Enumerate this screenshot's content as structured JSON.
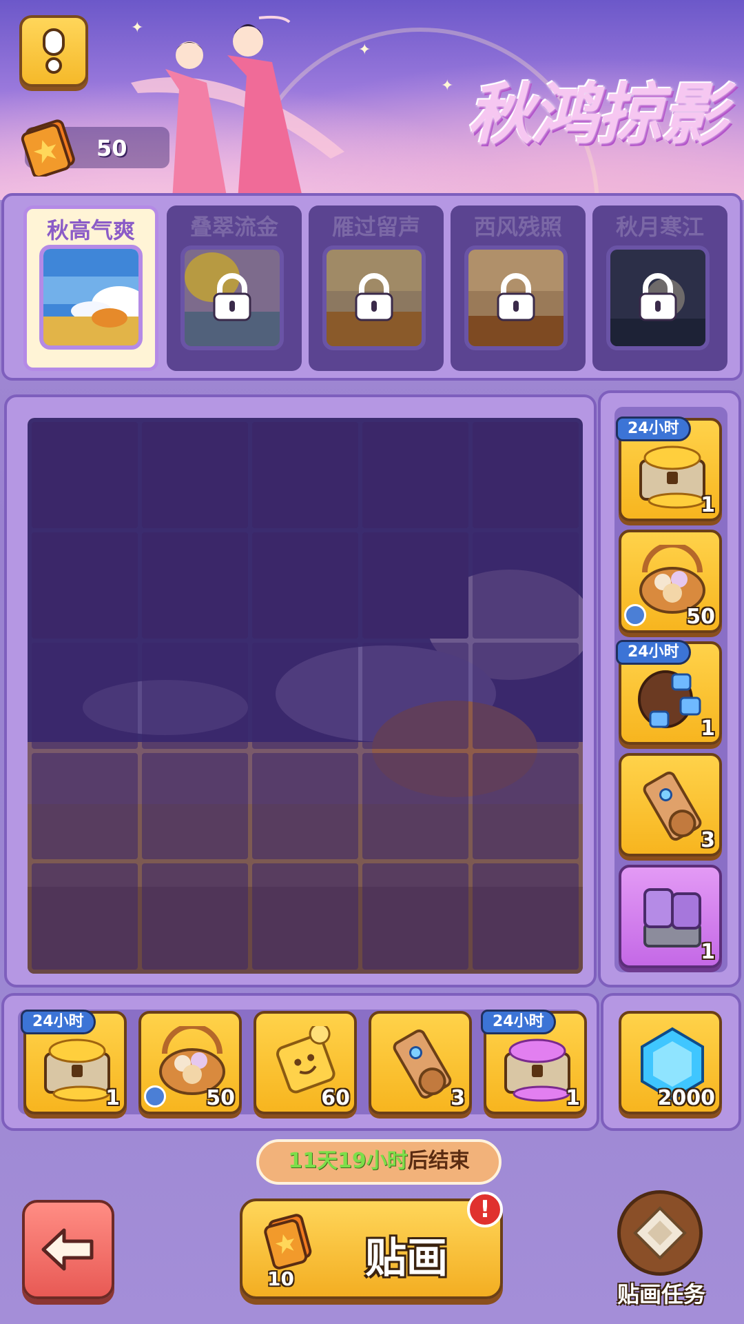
{
  "event": {
    "title": "秋鸿掠影",
    "card_count": "50"
  },
  "stages": [
    {
      "label": "秋高气爽",
      "locked": false
    },
    {
      "label": "叠翠流金",
      "locked": true
    },
    {
      "label": "雁过留声",
      "locked": true
    },
    {
      "label": "西风残照",
      "locked": true
    },
    {
      "label": "秋月寒江",
      "locked": true
    }
  ],
  "side_rewards": [
    {
      "icon": "gold-chest-icon",
      "tag": "24小时",
      "qty": "1"
    },
    {
      "icon": "cookie-basket-icon",
      "tag": "",
      "qty": "50",
      "timed": true
    },
    {
      "icon": "gem-bag-icon",
      "tag": "24小时",
      "qty": "1"
    },
    {
      "icon": "scroll-icon",
      "tag": "",
      "qty": "3"
    },
    {
      "icon": "purple-crystal-icon",
      "tag": "",
      "qty": "1"
    }
  ],
  "bottom_rewards": [
    {
      "icon": "gold-chest-icon",
      "tag": "24小时",
      "qty": "1"
    },
    {
      "icon": "cookie-basket-icon",
      "tag": "",
      "qty": "50",
      "timed": true
    },
    {
      "icon": "puzzle-piece-icon",
      "tag": "",
      "qty": "60"
    },
    {
      "icon": "scroll-icon",
      "tag": "",
      "qty": "3"
    },
    {
      "icon": "purple-gem-chest-icon",
      "tag": "24小时",
      "qty": "1"
    }
  ],
  "grand_reward": {
    "icon": "blue-diamond-icon",
    "qty": "2000"
  },
  "timer": {
    "highlight": "11天19小时",
    "suffix": "后结束"
  },
  "actions": {
    "paste_label": "贴画",
    "paste_cost": "10",
    "alert": "!",
    "task_label": "贴画任务"
  },
  "board": {
    "rows": 5,
    "cols": 5,
    "revealed_cells": 0
  }
}
